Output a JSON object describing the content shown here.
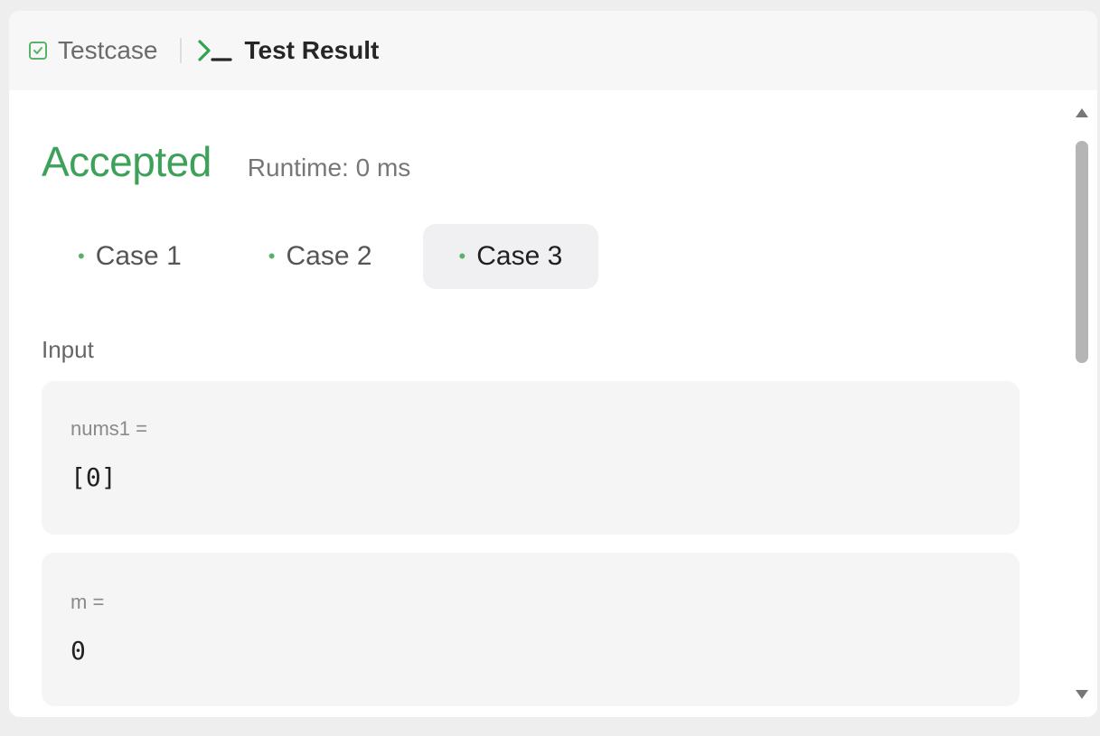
{
  "tabs": {
    "testcase_label": "Testcase",
    "result_label": "Test Result"
  },
  "result": {
    "status": "Accepted",
    "runtime": "Runtime: 0 ms"
  },
  "cases": [
    {
      "label": "Case 1",
      "active": false
    },
    {
      "label": "Case 2",
      "active": false
    },
    {
      "label": "Case 3",
      "active": true
    }
  ],
  "input": {
    "label": "Input",
    "params": [
      {
        "name": "nums1 =",
        "value": "[0]"
      },
      {
        "name": "m =",
        "value": "0"
      }
    ]
  },
  "colors": {
    "accepted": "#3ea15a",
    "dot": "#58b368",
    "param_bg": "#f5f5f5",
    "active_case_bg": "#f0f0f2"
  },
  "icons": {
    "testcase": "checkbox-icon",
    "result": "terminal-icon"
  }
}
